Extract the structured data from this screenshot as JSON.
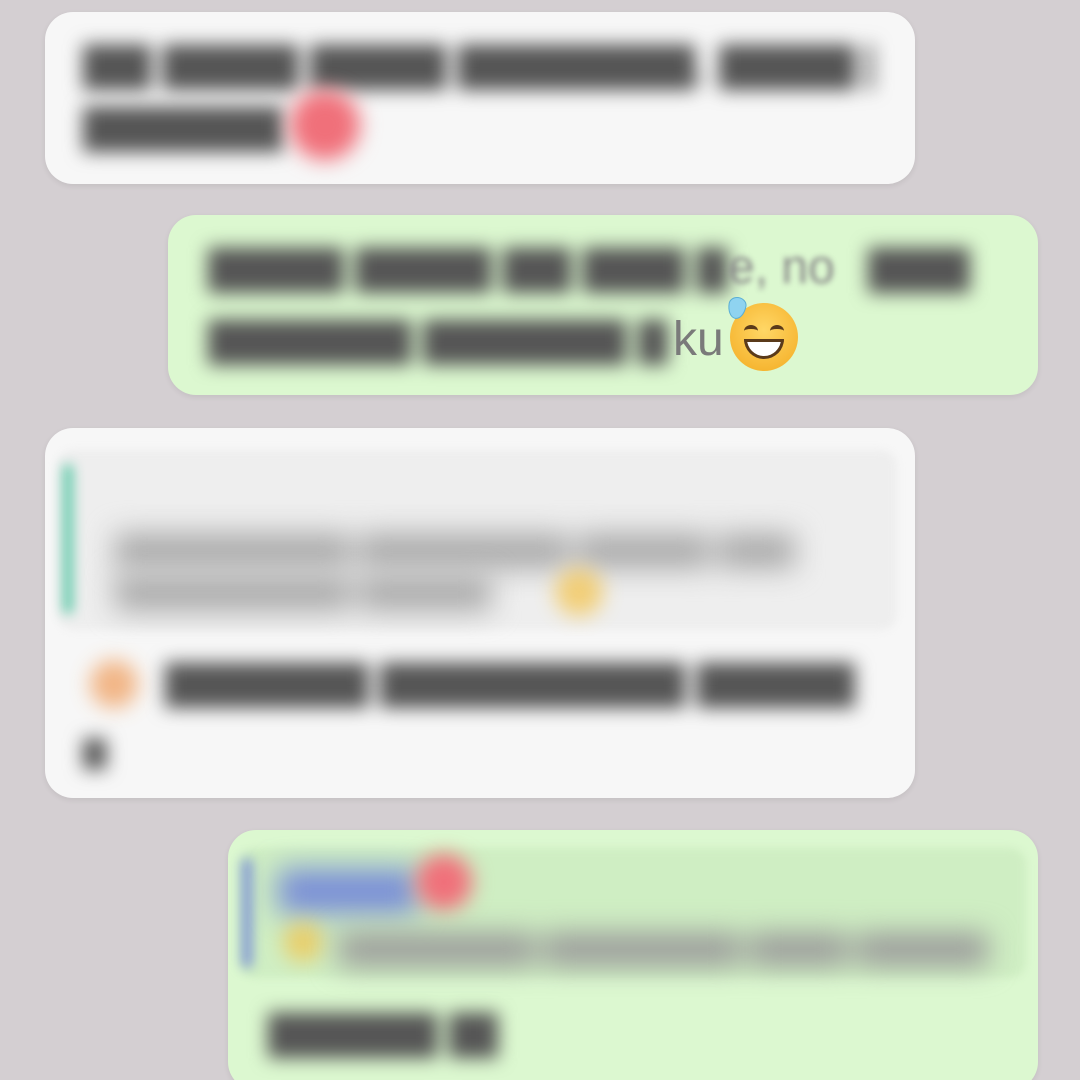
{
  "chat": {
    "messages": [
      {
        "direction": "incoming",
        "text_line1": "",
        "text_line2": "",
        "time": ""
      },
      {
        "direction": "outgoing",
        "text_line1_visible": "e, no",
        "text_line2_visible": "ku",
        "emoji": "sweat-smile",
        "time": ""
      },
      {
        "direction": "incoming",
        "quoted_name": "",
        "quoted_text": "",
        "text": "",
        "time": ""
      },
      {
        "direction": "outgoing",
        "quoted_name": "",
        "quoted_text": "",
        "text": "",
        "time": ""
      }
    ]
  },
  "colors": {
    "background": "#d4cfd2",
    "incoming_bubble": "#f7f7f7",
    "outgoing_bubble": "#dcf8d0",
    "quote_bar_green": "#5ec9a8",
    "quote_bar_blue": "#7a8fd6"
  }
}
